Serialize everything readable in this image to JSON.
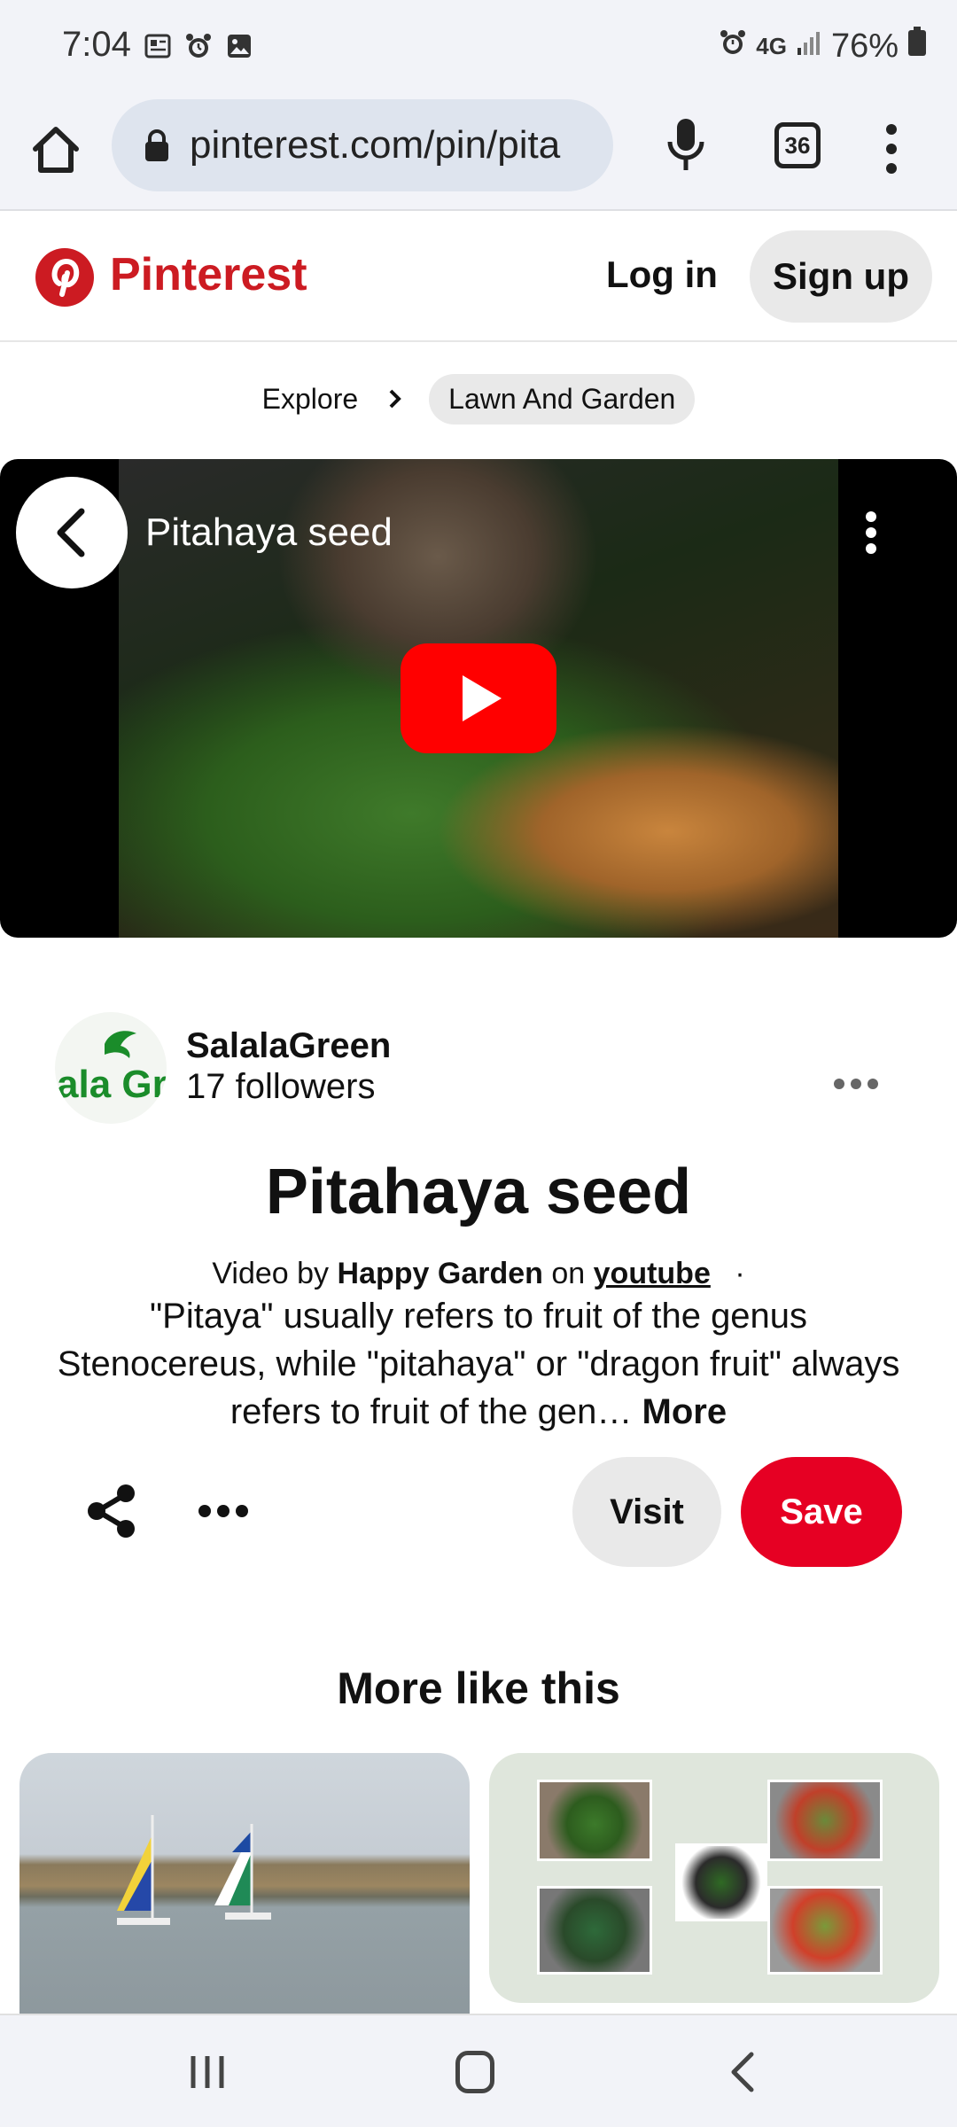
{
  "status_bar": {
    "time": "7:04",
    "battery": "76%",
    "network": "4G"
  },
  "browser": {
    "url": "pinterest.com/pin/pita",
    "tab_count": "36"
  },
  "header": {
    "brand": "Pinterest",
    "login_label": "Log in",
    "signup_label": "Sign up",
    "brand_color": "#cc1b22"
  },
  "breadcrumb": {
    "explore": "Explore",
    "category": "Lawn And Garden"
  },
  "video": {
    "title": "Pitahaya seed"
  },
  "creator": {
    "name": "SalalaGreen",
    "followers": "17 followers"
  },
  "pin": {
    "title": "Pitahaya seed",
    "source_prefix": "Video by",
    "source_author": "Happy Garden",
    "source_on": "on",
    "source_site": "youtube",
    "source_dot": "·",
    "description": "\"Pitaya\" usually refers to fruit of the genus Stenocereus, while \"pitahaya\" or \"dragon fruit\" always refers to fruit of the gen…",
    "more_label": "More"
  },
  "actions": {
    "visit_label": "Visit",
    "save_label": "Save",
    "save_color": "#e60023"
  },
  "related": {
    "heading": "More like this"
  }
}
